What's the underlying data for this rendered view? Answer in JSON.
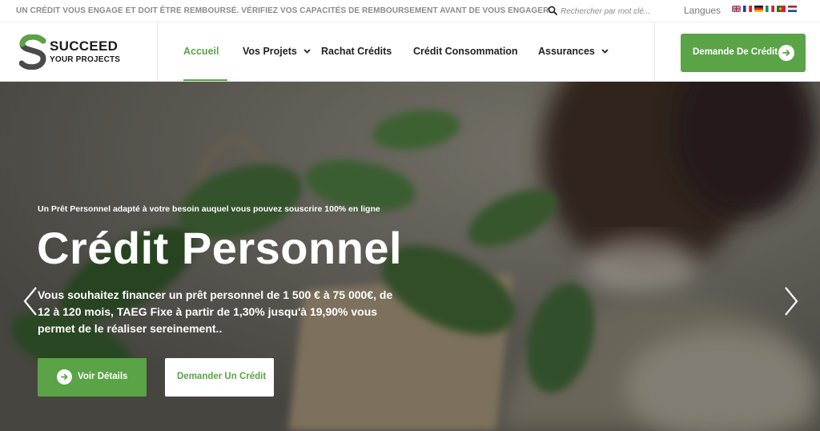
{
  "topbar": {
    "notice": "UN CRÉDIT VOUS ENGAGE ET DOIT ÊTRE REMBOURSÉ. VÉRIFIEZ VOS CAPACITÉS DE REMBOURSEMENT AVANT DE VOUS ENGAGER.",
    "search_placeholder": "Rechercher par mot clé...",
    "search_value": "",
    "search_icon": "search-icon",
    "languages_label": "Langues",
    "flags": [
      "flag-uk-icon",
      "flag-fr-icon",
      "flag-de-icon",
      "flag-it-icon",
      "flag-pt-icon",
      "flag-nl-icon"
    ]
  },
  "logo": {
    "line1": "SUCCEED",
    "line2": "YOUR PROJECTS"
  },
  "nav": {
    "items": [
      {
        "label": "Accueil",
        "active": true,
        "has_dropdown": false
      },
      {
        "label": "Vos Projets",
        "active": false,
        "has_dropdown": true
      },
      {
        "label": "Rachat Crédits",
        "active": false,
        "has_dropdown": false
      },
      {
        "label": "Crédit Consommation",
        "active": false,
        "has_dropdown": false
      },
      {
        "label": "Assurances",
        "active": false,
        "has_dropdown": true
      }
    ],
    "cta_label": "Demande De Crédit"
  },
  "hero": {
    "eyebrow": "Un Prêt Personnel adapté à votre besoin auquel vous pouvez souscrire 100% en ligne",
    "title": "Crédit Personnel",
    "description": "Vous souhaitez financer un prêt personnel de 1 500 € à 75 000€, de 12 à 120 mois, TAEG Fixe à partir de 1,30% jusqu'à 19,90% vous permet de le réaliser sereinement..",
    "primary_button": "Voir Détails",
    "secondary_button": "Demander Un Crédit"
  },
  "colors": {
    "brand_green": "#5aa346",
    "text_dark": "#222222",
    "muted_gray": "#8a8a8a"
  }
}
